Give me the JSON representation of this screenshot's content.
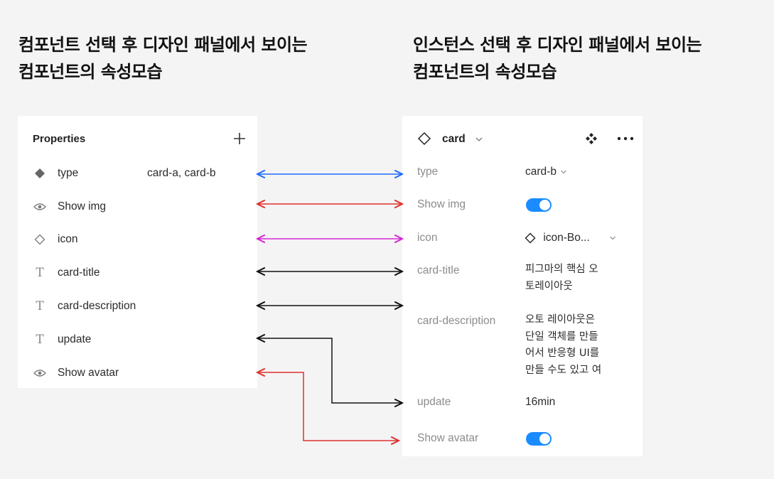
{
  "headings": {
    "left": [
      "컴포넌트 선택 후 디자인 패널에서 보이는",
      "컴포넌트의 속성모습"
    ],
    "right": [
      "인스턴스 선택 후 디자인 패널에서 보이는",
      "컴포넌트의 속성모습"
    ]
  },
  "left_panel": {
    "title": "Properties",
    "add_icon": "plus-icon",
    "rows": [
      {
        "icon": "variant-filled-diamond-icon",
        "label": "type",
        "value": "card-a, card-b"
      },
      {
        "icon": "eye-icon",
        "label": "Show img"
      },
      {
        "icon": "diamond-outline-icon",
        "label": "icon"
      },
      {
        "icon": "text-icon",
        "label": "card-title"
      },
      {
        "icon": "text-icon",
        "label": "card-description"
      },
      {
        "icon": "text-icon",
        "label": "update"
      },
      {
        "icon": "eye-icon",
        "label": "Show avatar"
      }
    ]
  },
  "right_panel": {
    "title": "card",
    "props": {
      "type": {
        "label": "type",
        "value": "card-b"
      },
      "show_img": {
        "label": "Show img",
        "on": true
      },
      "icon": {
        "label": "icon",
        "value": "icon-Bo..."
      },
      "card_title": {
        "label": "card-title",
        "lines": [
          "피그마의 핵심 오",
          "토레이아웃"
        ]
      },
      "card_description": {
        "label": "card-description",
        "lines": [
          "오토 레이아웃은",
          "단일 객체를 만들",
          "어서 반응형 UI를",
          "만들 수도 있고 여"
        ]
      },
      "update": {
        "label": "update",
        "value": "16min"
      },
      "show_avatar": {
        "label": "Show avatar",
        "on": true
      }
    }
  },
  "colors": {
    "background": "#f4f4f4",
    "panel": "#ffffff",
    "toggle_on": "#1a8cff",
    "arrow_type": "#1f6bff",
    "arrow_boolean": "#e0302e",
    "arrow_instance_swap": "#d426d4",
    "arrow_text": "#111111"
  }
}
